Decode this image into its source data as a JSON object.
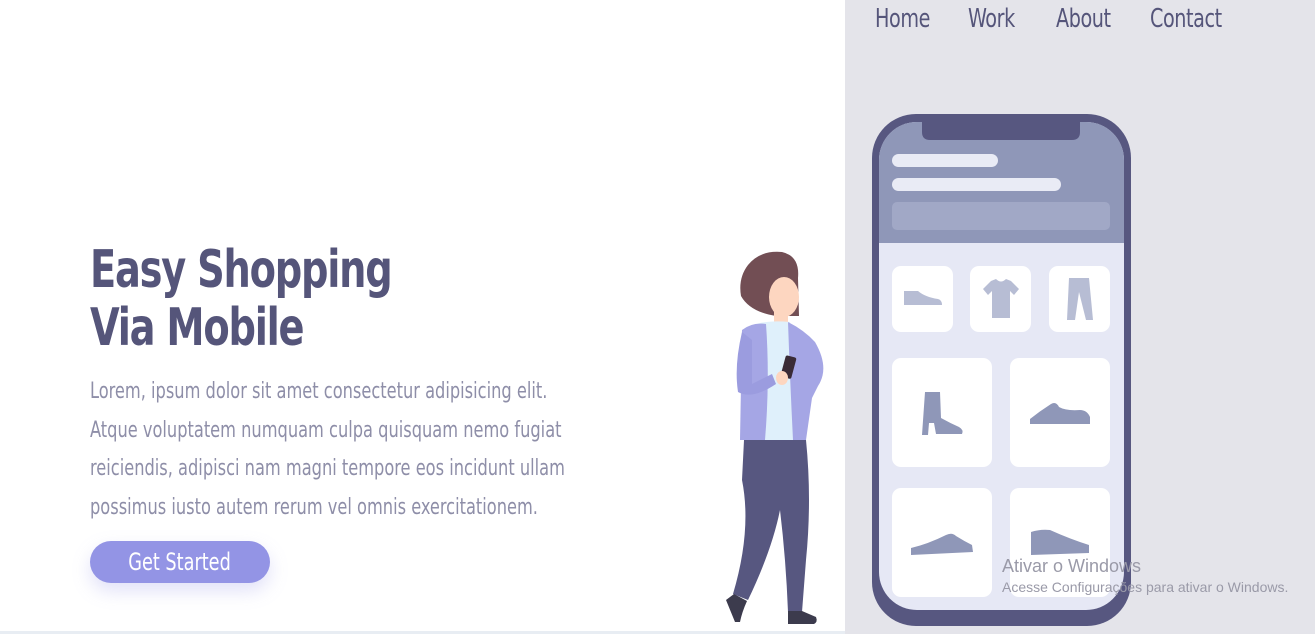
{
  "nav": {
    "items": [
      {
        "label": "Home"
      },
      {
        "label": "Work"
      },
      {
        "label": "About"
      },
      {
        "label": "Contact"
      }
    ]
  },
  "hero": {
    "title_line1": "Easy Shopping",
    "title_line2": "Via Mobile",
    "description": "Lorem, ipsum dolor sit amet consectetur adipisicing elit. Atque voluptatem numquam culpa quisquam nemo fugiat reiciendis, adipisci nam magni tempore eos incidunt ullam possimus iusto autem rerum vel omnis exercitationem.",
    "cta_label": "Get Started"
  },
  "product_icons": [
    "shoe-icon",
    "tshirt-icon",
    "pants-icon",
    "boot-icon",
    "sneaker-icon",
    "flat-shoe-icon",
    "sneaker-icon"
  ],
  "colors": {
    "heading": "#55557a",
    "body_text": "#8e8ea8",
    "accent": "#9394e5",
    "panel_bg": "#e4e4ea",
    "phone_frame": "#575780",
    "phone_header": "#8f97b8"
  },
  "watermark": {
    "title": "Ativar o Windows",
    "subtitle": "Acesse Configurações para ativar o Windows."
  }
}
